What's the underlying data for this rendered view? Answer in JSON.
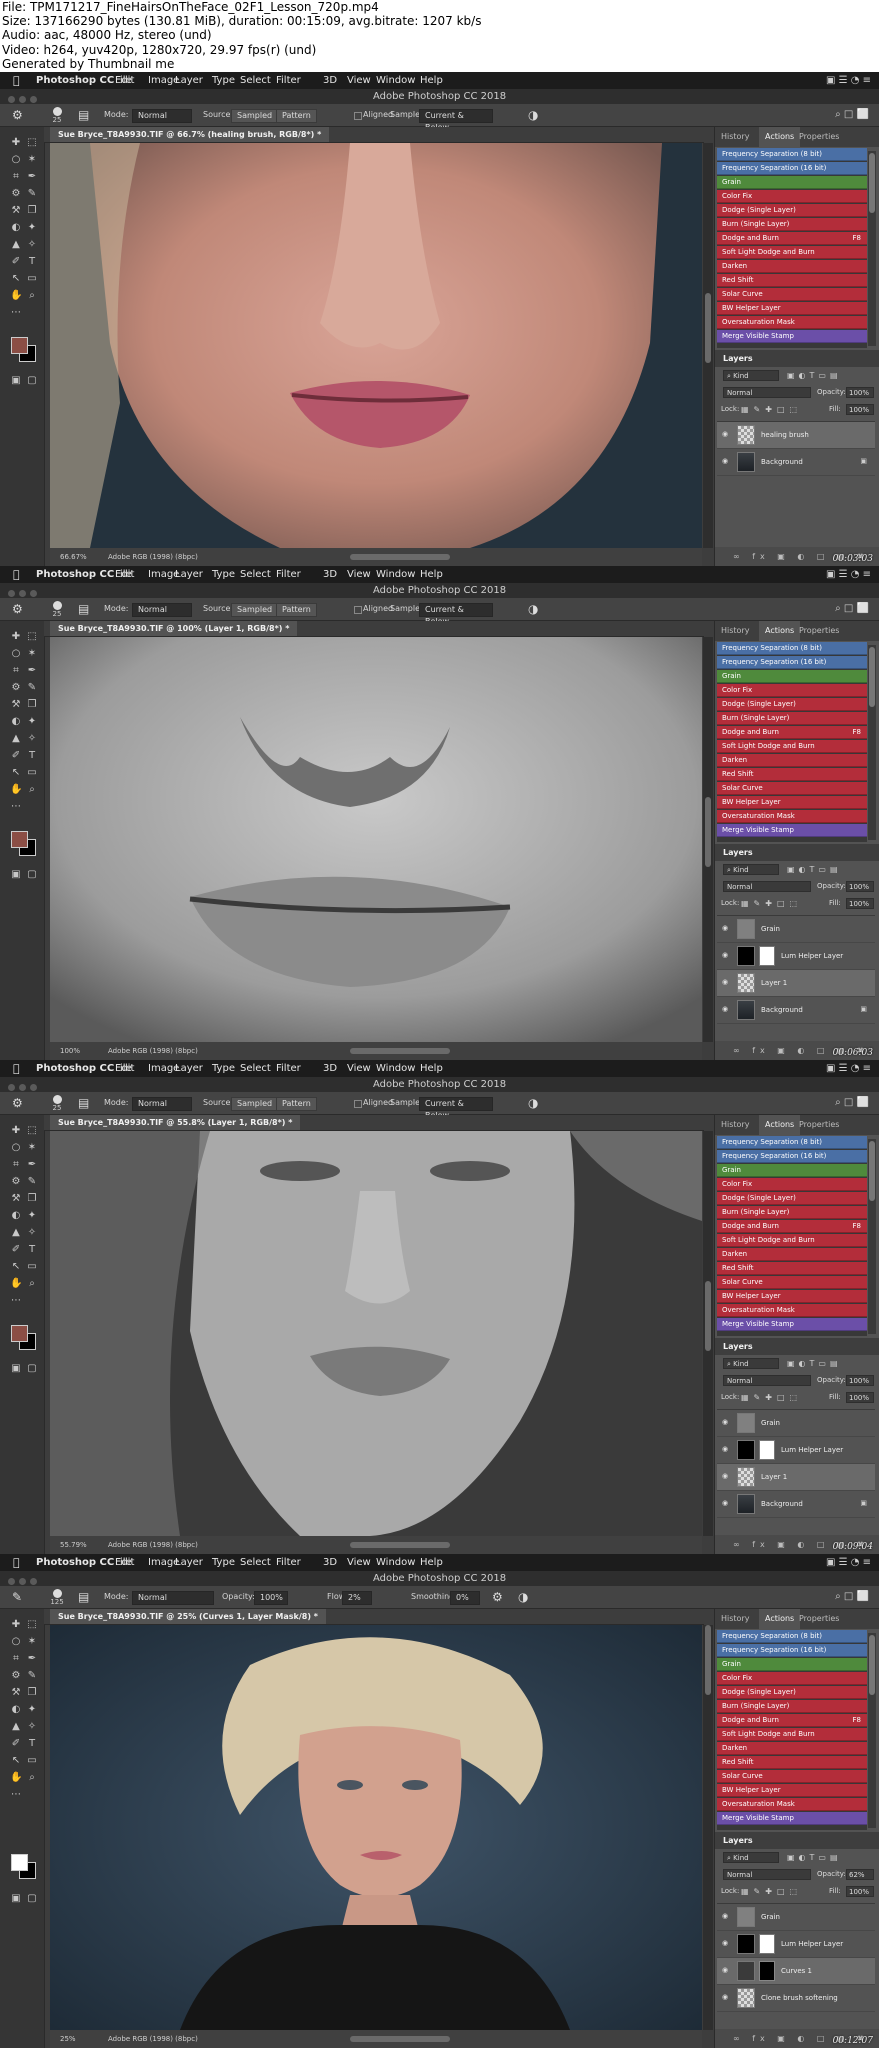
{
  "header": {
    "lines": [
      "File: TPM171217_FineHairsOnTheFace_02F1_Lesson_720p.mp4",
      "Size: 137166290 bytes (130.81 MiB), duration: 00:15:09, avg.bitrate: 1207 kb/s",
      "Audio: aac, 48000 Hz, stereo (und)",
      "Video: h264, yuv420p, 1280x720, 29.97 fps(r) (und)",
      "Generated by Thumbnail me"
    ]
  },
  "menu": {
    "app": "Photoshop CC",
    "items": [
      "File",
      "Edit",
      "Image",
      "Layer",
      "Type",
      "Select",
      "Filter",
      "3D",
      "View",
      "Window",
      "Help"
    ],
    "window_title": "Adobe Photoshop CC 2018"
  },
  "options_heal": {
    "brush_size": "25",
    "mode_label": "Mode:",
    "mode_value": "Normal",
    "source_label": "Source:",
    "source_sampled": "Sampled",
    "source_pattern": "Pattern",
    "aligned_label": "Aligned",
    "sample_label": "Sample:",
    "sample_value": "Current & Below"
  },
  "options_brush": {
    "brush_size": "125",
    "mode_label": "Mode:",
    "mode_value": "Normal",
    "opacity_label": "Opacity:",
    "opacity_value": "100%",
    "flow_label": "Flow:",
    "flow_value": "2%",
    "smoothing_label": "Smoothing:",
    "smoothing_value": "0%"
  },
  "panel": {
    "tabs": [
      "History",
      "Actions",
      "Properties"
    ],
    "actions": [
      {
        "label": "Frequency Separation (8 bit)",
        "color": "#4a6fa5",
        "fkey": ""
      },
      {
        "label": "Frequency Separation (16 bit)",
        "color": "#4a6fa5",
        "fkey": ""
      },
      {
        "label": "Grain",
        "color": "#4f8a3c",
        "fkey": ""
      },
      {
        "label": "Color Fix",
        "color": "#b32d3a",
        "fkey": ""
      },
      {
        "label": "Dodge (Single Layer)",
        "color": "#b32d3a",
        "fkey": ""
      },
      {
        "label": "Burn (Single Layer)",
        "color": "#b32d3a",
        "fkey": ""
      },
      {
        "label": "Dodge and Burn",
        "color": "#b32d3a",
        "fkey": "F8"
      },
      {
        "label": "Soft Light Dodge and Burn",
        "color": "#b32d3a",
        "fkey": ""
      },
      {
        "label": "Darken",
        "color": "#b32d3a",
        "fkey": ""
      },
      {
        "label": "Red Shift",
        "color": "#b32d3a",
        "fkey": ""
      },
      {
        "label": "Solar Curve",
        "color": "#b32d3a",
        "fkey": ""
      },
      {
        "label": "BW Helper Layer",
        "color": "#b32d3a",
        "fkey": ""
      },
      {
        "label": "Oversaturation Mask",
        "color": "#b32d3a",
        "fkey": ""
      },
      {
        "label": "Merge Visible Stamp",
        "color": "#6b4fa8",
        "fkey": ""
      }
    ],
    "layers_title": "Layers",
    "kind_label": "Kind",
    "lock_label": "Lock:",
    "opacity_label": "Opacity:",
    "fill_label": "Fill:",
    "fill_value": "100%"
  },
  "frames": [
    {
      "doc_tab": "Sue Bryce_T8A9930.TIF @ 66.7% (healing brush, RGB/8*) *",
      "zoom": "66.67%",
      "profile": "Adobe RGB (1998) (8bpc)",
      "blend_mode": "Normal",
      "opacity": "100%",
      "timecode": "00:03:03",
      "layers": [
        {
          "name": "healing brush",
          "type": "transparent",
          "selected": true,
          "lock": false
        },
        {
          "name": "Background",
          "type": "photo",
          "selected": false,
          "lock": true
        }
      ]
    },
    {
      "doc_tab": "Sue Bryce_T8A9930.TIF @ 100% (Layer 1, RGB/8*) *",
      "zoom": "100%",
      "profile": "Adobe RGB (1998) (8bpc)",
      "blend_mode": "Normal",
      "opacity": "100%",
      "timecode": "00:06:03",
      "layers": [
        {
          "name": "Grain",
          "type": "gray",
          "selected": false,
          "lock": false
        },
        {
          "name": "Lum Helper Layer",
          "type": "adjust",
          "selected": false,
          "lock": false
        },
        {
          "name": "Layer 1",
          "type": "transparent",
          "selected": true,
          "lock": false
        },
        {
          "name": "Background",
          "type": "photo",
          "selected": false,
          "lock": true
        }
      ]
    },
    {
      "doc_tab": "Sue Bryce_T8A9930.TIF @ 55.8% (Layer 1, RGB/8*) *",
      "zoom": "55.79%",
      "profile": "Adobe RGB (1998) (8bpc)",
      "blend_mode": "Normal",
      "opacity": "100%",
      "timecode": "00:09:04",
      "layers": [
        {
          "name": "Grain",
          "type": "gray",
          "selected": false,
          "lock": false
        },
        {
          "name": "Lum Helper Layer",
          "type": "adjust",
          "selected": false,
          "lock": false
        },
        {
          "name": "Layer 1",
          "type": "transparent",
          "selected": true,
          "lock": false
        },
        {
          "name": "Background",
          "type": "photo",
          "selected": false,
          "lock": true
        }
      ]
    },
    {
      "doc_tab": "Sue Bryce_T8A9930.TIF @ 25% (Curves 1, Layer Mask/8) *",
      "zoom": "25%",
      "profile": "Adobe RGB (1998) (8bpc)",
      "blend_mode": "Normal",
      "opacity": "62%",
      "timecode": "00:12:07",
      "layers": [
        {
          "name": "Grain",
          "type": "gray",
          "selected": false,
          "lock": false
        },
        {
          "name": "Lum Helper Layer",
          "type": "adjust",
          "selected": false,
          "lock": false
        },
        {
          "name": "Curves 1",
          "type": "curves",
          "selected": true,
          "lock": false
        },
        {
          "name": "Clone brush softening",
          "type": "transparent",
          "selected": false,
          "lock": false
        }
      ]
    }
  ]
}
